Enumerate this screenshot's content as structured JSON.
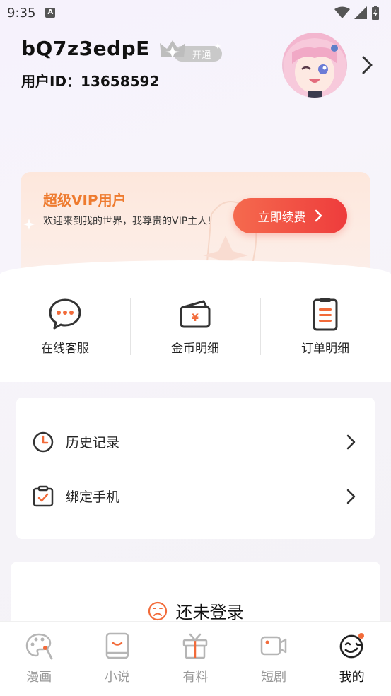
{
  "status_bar": {
    "time": "9:35"
  },
  "profile": {
    "username": "bQ7z3edpE",
    "vip_badge_label": "开通",
    "user_id_label": "用户ID：",
    "user_id": "13658592"
  },
  "vip_card": {
    "title": "超级VIP用户",
    "description": "欢迎来到我的世界，我尊贵的VIP主人!",
    "renew_button": "立即续费"
  },
  "quick_actions": [
    {
      "label": "在线客服",
      "icon": "chat-bubble-icon"
    },
    {
      "label": "金币明细",
      "icon": "wallet-icon"
    },
    {
      "label": "订单明细",
      "icon": "order-list-icon"
    }
  ],
  "menu": [
    {
      "label": "历史记录",
      "icon": "clock-icon"
    },
    {
      "label": "绑定手机",
      "icon": "clipboard-check-icon"
    }
  ],
  "login_prompt": {
    "text": "还未登录"
  },
  "tabs": [
    {
      "label": "漫画",
      "icon": "palette-icon",
      "active": false
    },
    {
      "label": "小说",
      "icon": "book-icon",
      "active": false
    },
    {
      "label": "有料",
      "icon": "gift-box-icon",
      "active": false
    },
    {
      "label": "短剧",
      "icon": "video-camera-icon",
      "active": false
    },
    {
      "label": "我的",
      "icon": "profile-face-icon",
      "active": true
    }
  ],
  "colors": {
    "accent_orange": "#ee7b2f",
    "button_red": "#ee3c3c",
    "icon_orange": "#f26b3a"
  }
}
